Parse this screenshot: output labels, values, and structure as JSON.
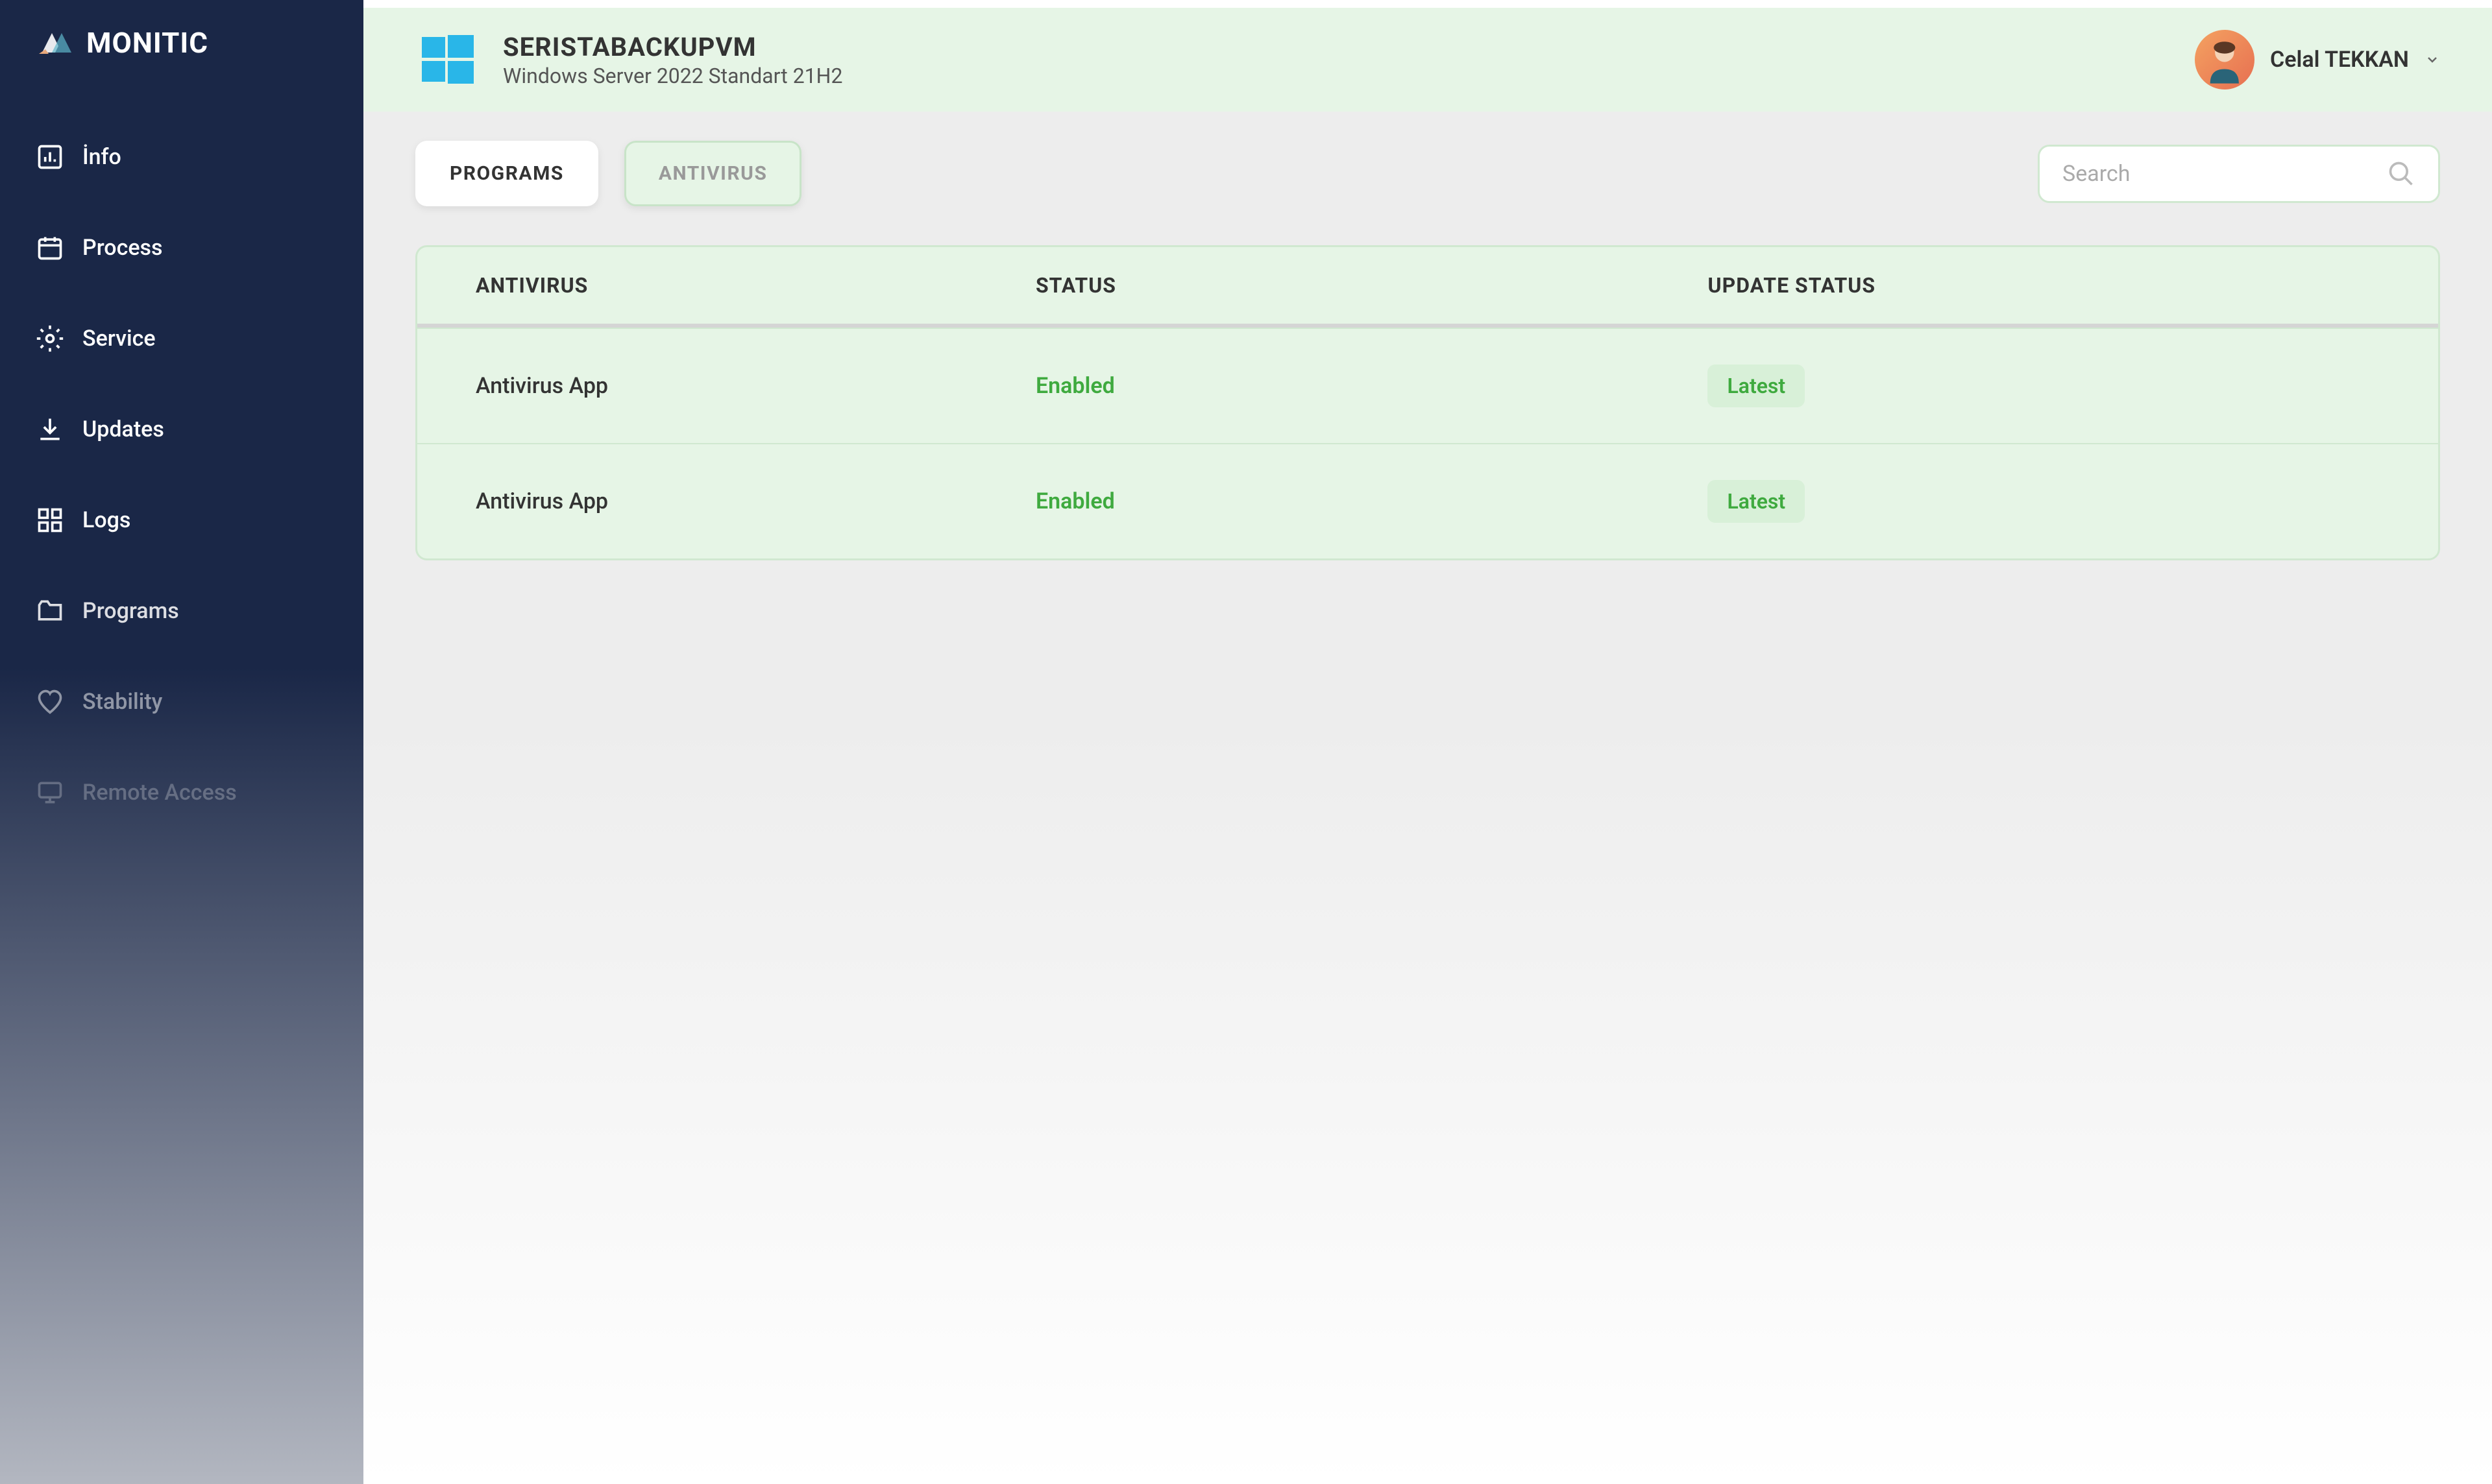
{
  "brand": "MONITIC",
  "sidebar": {
    "items": [
      {
        "label": "İnfo"
      },
      {
        "label": "Process"
      },
      {
        "label": "Service"
      },
      {
        "label": "Updates"
      },
      {
        "label": "Logs"
      },
      {
        "label": "Programs"
      },
      {
        "label": "Stability"
      },
      {
        "label": "Remote Access"
      }
    ]
  },
  "header": {
    "title": "SERISTABACKUPVM",
    "subtitle": "Windows Server 2022 Standart 21H2",
    "user_name": "Celal TEKKAN"
  },
  "tabs": [
    {
      "label": "PROGRAMS",
      "active": false
    },
    {
      "label": "ANTIVIRUS",
      "active": true
    }
  ],
  "search": {
    "placeholder": "Search"
  },
  "table": {
    "columns": [
      "ANTIVIRUS",
      "STATUS",
      "UPDATE STATUS"
    ],
    "rows": [
      {
        "name": "Antivirus App",
        "status": "Enabled",
        "update": "Latest"
      },
      {
        "name": "Antivirus App",
        "status": "Enabled",
        "update": "Latest"
      }
    ]
  }
}
